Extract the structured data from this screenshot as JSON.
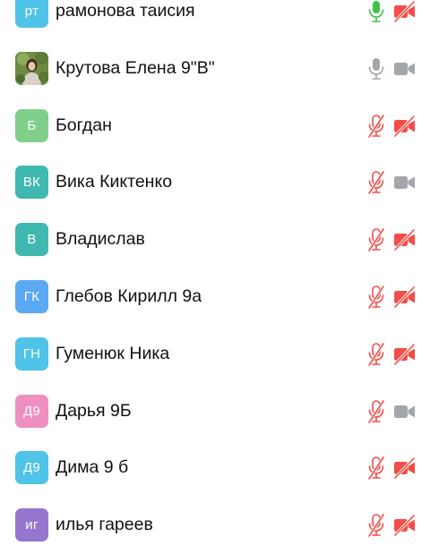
{
  "participants": [
    {
      "initials": "рт",
      "name": "рамонова таисия",
      "avatar_color": "#4fc3e8",
      "mic": "on",
      "camera": "off",
      "photo": false
    },
    {
      "initials": "",
      "name": "Крутова Елена 9\"В\"",
      "avatar_color": "#7a9a4e",
      "mic": "idle",
      "camera": "idle",
      "photo": true
    },
    {
      "initials": "Б",
      "name": "Богдан",
      "avatar_color": "#7fcf8a",
      "mic": "off",
      "camera": "off",
      "photo": false
    },
    {
      "initials": "ВК",
      "name": "Вика Киктенко",
      "avatar_color": "#3fb8b0",
      "mic": "off",
      "camera": "idle",
      "photo": false
    },
    {
      "initials": "В",
      "name": "Владислав",
      "avatar_color": "#3fb8b0",
      "mic": "off",
      "camera": "off",
      "photo": false
    },
    {
      "initials": "ГК",
      "name": "Глебов Кирилл 9а",
      "avatar_color": "#5aa9f2",
      "mic": "off",
      "camera": "off",
      "photo": false
    },
    {
      "initials": "ГН",
      "name": "Гуменюк Ника",
      "avatar_color": "#4fc3e8",
      "mic": "off",
      "camera": "off",
      "photo": false
    },
    {
      "initials": "Д9",
      "name": "Дарья 9Б",
      "avatar_color": "#ee8fbf",
      "mic": "off",
      "camera": "idle",
      "photo": false
    },
    {
      "initials": "Д9",
      "name": "Дима 9 б",
      "avatar_color": "#4fc3e8",
      "mic": "off",
      "camera": "off",
      "photo": false
    },
    {
      "initials": "иг",
      "name": "илья гареев",
      "avatar_color": "#9575cd",
      "mic": "off",
      "camera": "off",
      "photo": false
    }
  ],
  "colors": {
    "mic_on": "#3fc24a",
    "muted_red": "#f24d47",
    "idle_grey": "#a3a6ab"
  },
  "icons": {
    "mic": "microphone-icon",
    "mic_off": "microphone-muted-icon",
    "camera": "video-camera-icon",
    "camera_off": "video-camera-off-icon"
  }
}
